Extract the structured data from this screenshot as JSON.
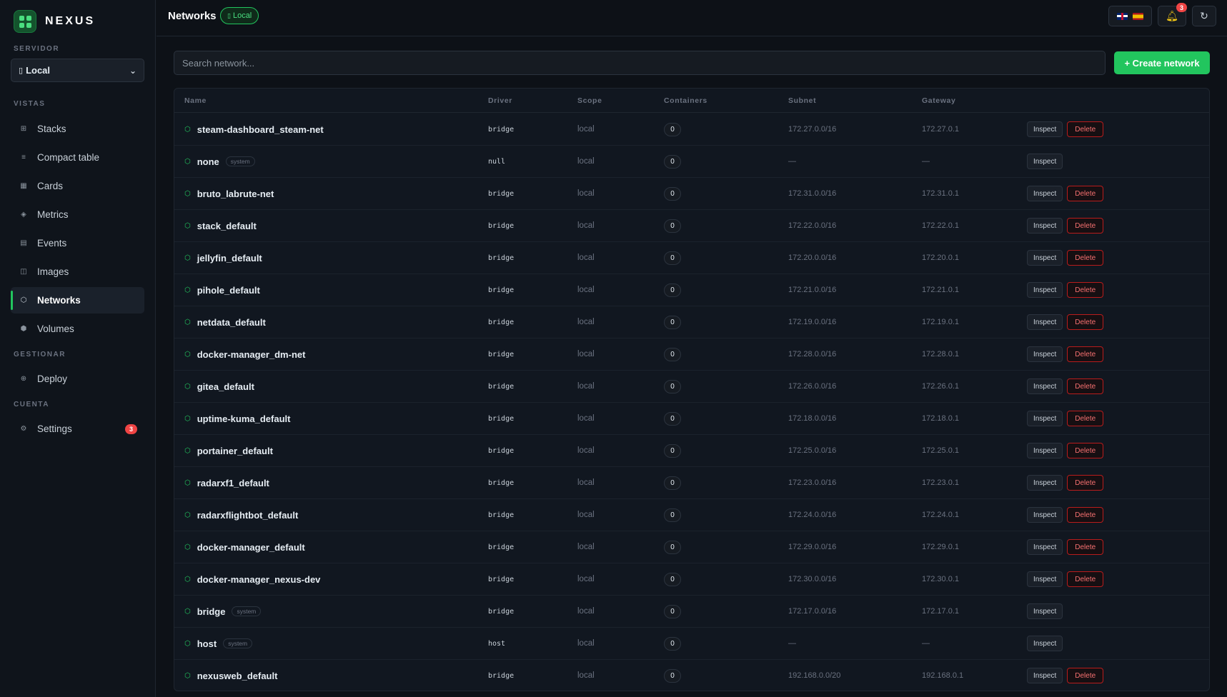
{
  "app": {
    "brand": "NEXUS"
  },
  "sidebar": {
    "server_label": "SERVIDOR",
    "server_value": "Local",
    "server_icon": "server-icon",
    "sections": [
      {
        "label": "VISTAS"
      },
      {
        "label": "GESTIONAR"
      },
      {
        "label": "CUENTA"
      }
    ],
    "items": [
      {
        "label": "Stacks",
        "icon": "grid-icon"
      },
      {
        "label": "Compact table",
        "icon": "list-icon"
      },
      {
        "label": "Cards",
        "icon": "cards-icon"
      },
      {
        "label": "Metrics",
        "icon": "diamond-icon"
      },
      {
        "label": "Events",
        "icon": "events-icon"
      },
      {
        "label": "Images",
        "icon": "images-icon"
      },
      {
        "label": "Networks",
        "icon": "network-icon",
        "active": true
      },
      {
        "label": "Volumes",
        "icon": "volume-icon"
      },
      {
        "label": "Deploy",
        "icon": "deploy-icon"
      },
      {
        "label": "Settings",
        "icon": "gear-icon",
        "badge": "3"
      }
    ]
  },
  "header": {
    "title": "Networks",
    "context_badge": "Local",
    "notifications_count": "3",
    "languages": [
      "en",
      "es"
    ]
  },
  "search": {
    "placeholder": "Search network...",
    "value": ""
  },
  "actions": {
    "create_label": "+ Create network"
  },
  "table": {
    "columns": [
      "Name",
      "Driver",
      "Scope",
      "Containers",
      "Subnet",
      "Gateway"
    ],
    "inspect_label": "Inspect",
    "delete_label": "Delete",
    "system_label": "system",
    "rows": [
      {
        "name": "steam-dashboard_steam-net",
        "driver": "bridge",
        "scope": "local",
        "containers": "0",
        "subnet": "172.27.0.0/16",
        "gateway": "172.27.0.1",
        "system": false
      },
      {
        "name": "none",
        "driver": "null",
        "scope": "local",
        "containers": "0",
        "subnet": "—",
        "gateway": "—",
        "system": true
      },
      {
        "name": "bruto_labrute-net",
        "driver": "bridge",
        "scope": "local",
        "containers": "0",
        "subnet": "172.31.0.0/16",
        "gateway": "172.31.0.1",
        "system": false
      },
      {
        "name": "stack_default",
        "driver": "bridge",
        "scope": "local",
        "containers": "0",
        "subnet": "172.22.0.0/16",
        "gateway": "172.22.0.1",
        "system": false
      },
      {
        "name": "jellyfin_default",
        "driver": "bridge",
        "scope": "local",
        "containers": "0",
        "subnet": "172.20.0.0/16",
        "gateway": "172.20.0.1",
        "system": false
      },
      {
        "name": "pihole_default",
        "driver": "bridge",
        "scope": "local",
        "containers": "0",
        "subnet": "172.21.0.0/16",
        "gateway": "172.21.0.1",
        "system": false
      },
      {
        "name": "netdata_default",
        "driver": "bridge",
        "scope": "local",
        "containers": "0",
        "subnet": "172.19.0.0/16",
        "gateway": "172.19.0.1",
        "system": false
      },
      {
        "name": "docker-manager_dm-net",
        "driver": "bridge",
        "scope": "local",
        "containers": "0",
        "subnet": "172.28.0.0/16",
        "gateway": "172.28.0.1",
        "system": false
      },
      {
        "name": "gitea_default",
        "driver": "bridge",
        "scope": "local",
        "containers": "0",
        "subnet": "172.26.0.0/16",
        "gateway": "172.26.0.1",
        "system": false
      },
      {
        "name": "uptime-kuma_default",
        "driver": "bridge",
        "scope": "local",
        "containers": "0",
        "subnet": "172.18.0.0/16",
        "gateway": "172.18.0.1",
        "system": false
      },
      {
        "name": "portainer_default",
        "driver": "bridge",
        "scope": "local",
        "containers": "0",
        "subnet": "172.25.0.0/16",
        "gateway": "172.25.0.1",
        "system": false
      },
      {
        "name": "radarxf1_default",
        "driver": "bridge",
        "scope": "local",
        "containers": "0",
        "subnet": "172.23.0.0/16",
        "gateway": "172.23.0.1",
        "system": false
      },
      {
        "name": "radarxflightbot_default",
        "driver": "bridge",
        "scope": "local",
        "containers": "0",
        "subnet": "172.24.0.0/16",
        "gateway": "172.24.0.1",
        "system": false
      },
      {
        "name": "docker-manager_default",
        "driver": "bridge",
        "scope": "local",
        "containers": "0",
        "subnet": "172.29.0.0/16",
        "gateway": "172.29.0.1",
        "system": false
      },
      {
        "name": "docker-manager_nexus-dev",
        "driver": "bridge",
        "scope": "local",
        "containers": "0",
        "subnet": "172.30.0.0/16",
        "gateway": "172.30.0.1",
        "system": false
      },
      {
        "name": "bridge",
        "driver": "bridge",
        "scope": "local",
        "containers": "0",
        "subnet": "172.17.0.0/16",
        "gateway": "172.17.0.1",
        "system": true
      },
      {
        "name": "host",
        "driver": "host",
        "scope": "local",
        "containers": "0",
        "subnet": "—",
        "gateway": "—",
        "system": true
      },
      {
        "name": "nexusweb_default",
        "driver": "bridge",
        "scope": "local",
        "containers": "0",
        "subnet": "192.168.0.0/20",
        "gateway": "192.168.0.1",
        "system": false
      }
    ]
  },
  "colors": {
    "accent": "#22c55e",
    "danger": "#ef4444",
    "background": "#0d1117",
    "sidebar": "#0f141b"
  }
}
